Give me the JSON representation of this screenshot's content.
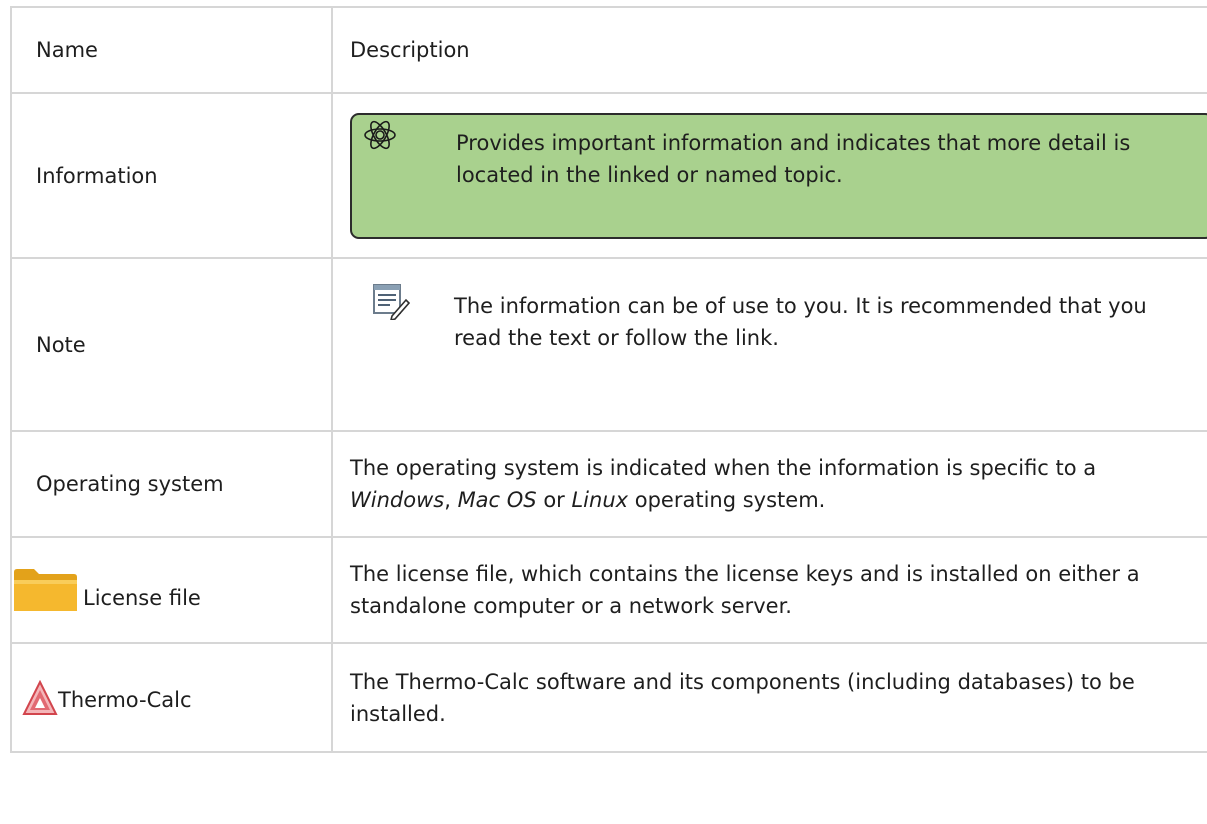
{
  "header": {
    "name": "Name",
    "description": "Description"
  },
  "rows": [
    {
      "name": "Information",
      "description": "Provides important information and indicates that more detail is located in the linked or named topic.",
      "icon": "atom-icon",
      "box_color": "#a9d18e"
    },
    {
      "name": "Note",
      "description": "The information can be of use to you. It is recommended that you read the text or follow the link.",
      "icon": "note-pencil-icon"
    },
    {
      "name": "Operating system",
      "description_parts": [
        "The operating system is indicated when the information is specific to a ",
        "Windows",
        ", ",
        "Mac OS",
        " or ",
        "Linux",
        " operating system."
      ]
    },
    {
      "name": "License file",
      "description": "The license file, which contains the license keys and is installed on either a standalone computer or a network server.",
      "icon": "folder-icon"
    },
    {
      "name": "Thermo-Calc",
      "description": "The Thermo-Calc software and its components (including databases) to be installed.",
      "icon": "thermo-calc-logo-icon"
    }
  ]
}
